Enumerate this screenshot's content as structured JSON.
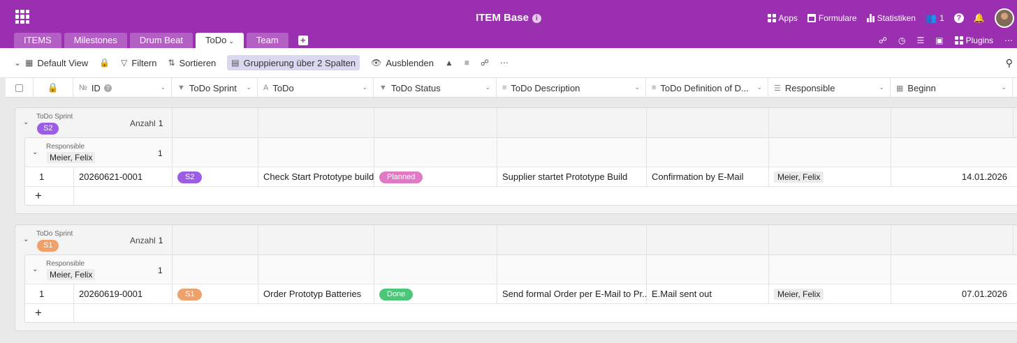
{
  "header": {
    "title": "ITEM Base",
    "menu": [
      {
        "label": "Apps",
        "icon": "apps-icon"
      },
      {
        "label": "Formulare",
        "icon": "forms-icon"
      },
      {
        "label": "Statistiken",
        "icon": "statistics-icon"
      },
      {
        "label": "1",
        "icon": "users-icon"
      }
    ],
    "plugins_label": "Plugins",
    "accent": "#9a2fb0"
  },
  "tabs": [
    {
      "label": "ITEMS"
    },
    {
      "label": "Milestones"
    },
    {
      "label": "Drum Beat"
    },
    {
      "label": "ToDo",
      "active": true
    },
    {
      "label": "Team"
    }
  ],
  "toolbar": {
    "view": "Default View",
    "filter": "Filtern",
    "sort": "Sortieren",
    "group": "Gruppierung über 2 Spalten",
    "hide": "Ausblenden"
  },
  "columns": [
    {
      "label": "ID"
    },
    {
      "label": "ToDo Sprint"
    },
    {
      "label": "ToDo"
    },
    {
      "label": "ToDo Status"
    },
    {
      "label": "ToDo Description"
    },
    {
      "label": "ToDo Definition of D..."
    },
    {
      "label": "Responsible"
    },
    {
      "label": "Beginn"
    }
  ],
  "groups": [
    {
      "group_label": "ToDo Sprint",
      "sprint": "S2",
      "sprint_color": "#9b5de5",
      "count_label": "Anzahl",
      "count": "1",
      "sub": {
        "label": "Responsible",
        "value": "Meier, Felix",
        "count": "1",
        "rows": [
          {
            "num": "1",
            "id": "20260621-0001",
            "sprint": "S2",
            "todo": "Check Start Prototype build",
            "status": "Planned",
            "status_color": "#e17ac5",
            "description": "Supplier startet Prototype Build",
            "definition": "Confirmation by E-Mail",
            "responsible": "Meier, Felix",
            "beginn": "14.01.2026"
          }
        ]
      }
    },
    {
      "group_label": "ToDo Sprint",
      "sprint": "S1",
      "sprint_color": "#f0a06a",
      "count_label": "Anzahl",
      "count": "1",
      "sub": {
        "label": "Responsible",
        "value": "Meier, Felix",
        "count": "1",
        "rows": [
          {
            "num": "1",
            "id": "20260619-0001",
            "sprint": "S1",
            "todo": "Order Prototyp Batteries",
            "status": "Done",
            "status_color": "#4cc777",
            "description": "Send formal Order per E-Mail to Pr...",
            "definition": "E.Mail sent out",
            "responsible": "Meier, Felix",
            "beginn": "07.01.2026"
          }
        ]
      }
    }
  ]
}
